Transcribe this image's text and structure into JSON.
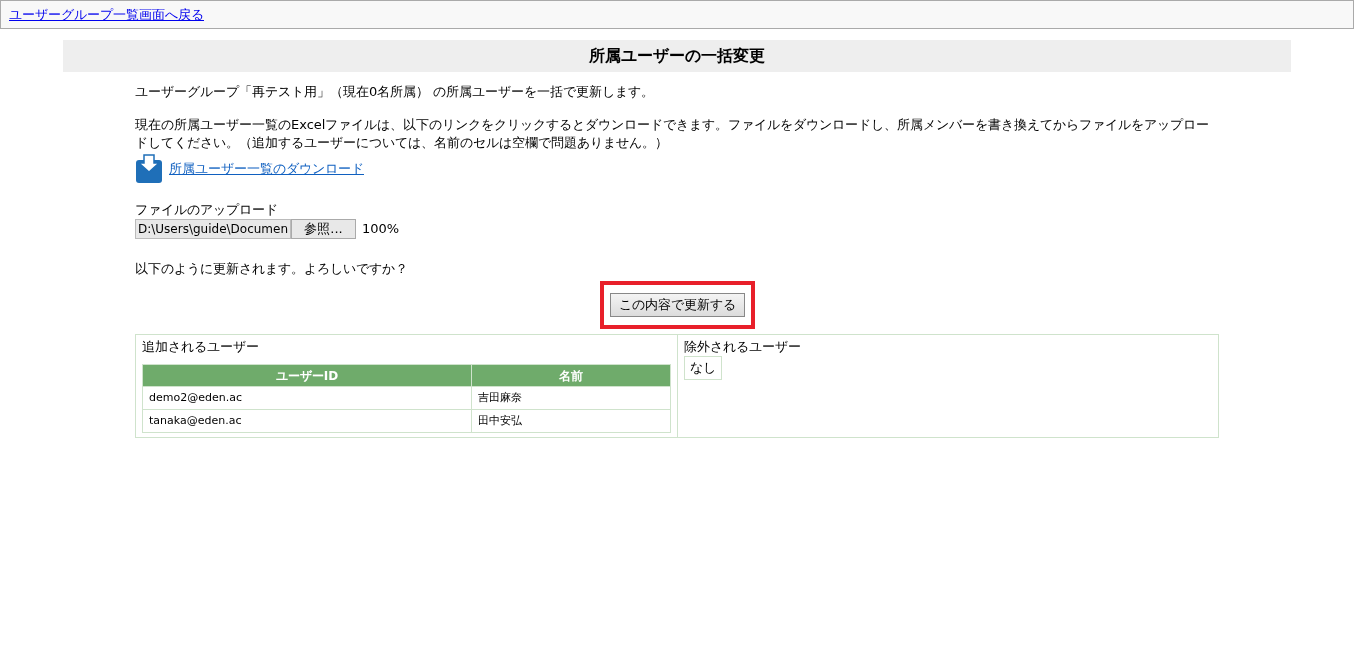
{
  "back_link": "ユーザーグループ一覧画面へ戻る",
  "heading": "所属ユーザーの一括変更",
  "intro": "ユーザーグループ「再テスト用」（現在0名所属） の所属ユーザーを一括で更新します。",
  "instructions": "現在の所属ユーザー一覧のExcelファイルは、以下のリンクをクリックするとダウンロードできます。ファイルをダウンロードし、所属メンバーを書き換えてからファイルをアップロードしてください。（追加するユーザーについては、名前のセルは空欄で問題ありません。）",
  "download_link": "所属ユーザー一覧のダウンロード",
  "upload": {
    "label": "ファイルのアップロード",
    "value": "D:\\Users\\guide\\Documen",
    "browse_button": "参照...",
    "progress": "100%"
  },
  "confirm_text": "以下のように更新されます。よろしいですか？",
  "update_button": {
    "label": "この内容で更新する",
    "highlighted": true
  },
  "added": {
    "title": "追加されるユーザー",
    "columns": [
      "ユーザーID",
      "名前"
    ],
    "rows": [
      [
        "demo2@eden.ac",
        "吉田麻奈"
      ],
      [
        "tanaka@eden.ac",
        "田中安弘"
      ]
    ]
  },
  "removed": {
    "title": "除外されるユーザー",
    "items": [
      "なし"
    ]
  }
}
